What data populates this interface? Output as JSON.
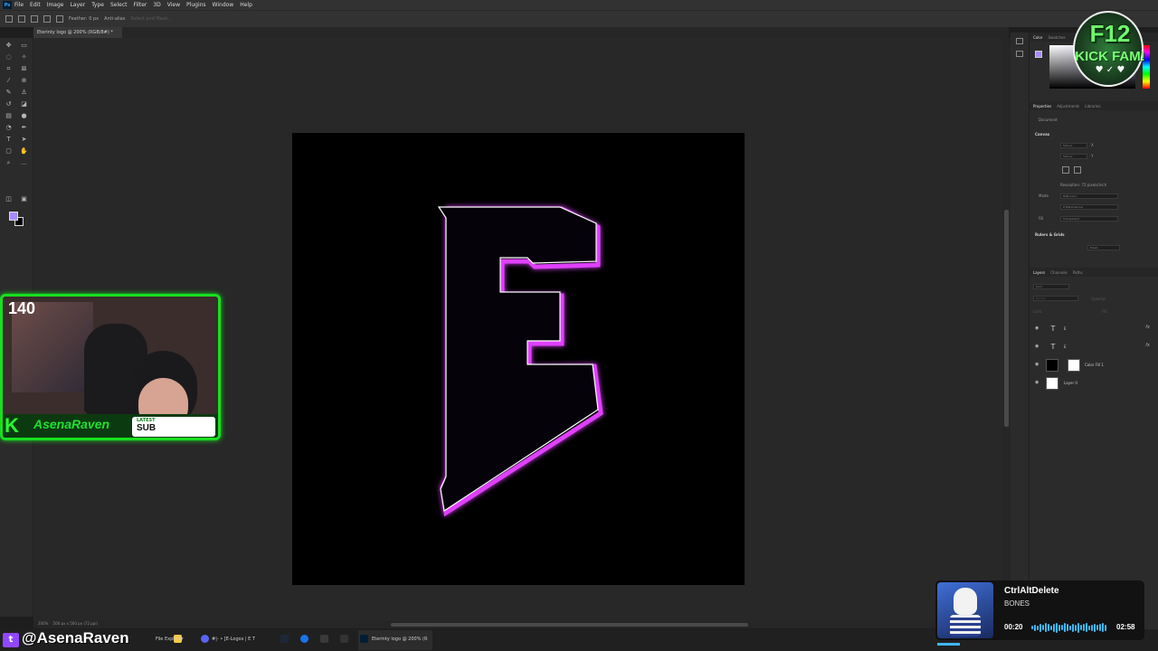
{
  "app": {
    "logo_glyph": "Ps",
    "menu": [
      "File",
      "Edit",
      "Image",
      "Layer",
      "Type",
      "Select",
      "Filter",
      "3D",
      "View",
      "Plugins",
      "Window",
      "Help"
    ]
  },
  "options_bar": {
    "feather": "Feather: 0 px",
    "anti_alias": "Anti-alias",
    "select_mask": "Select and Mask..."
  },
  "document": {
    "tab_title": "Eterinty logo @ 200% (RGB/8#) *",
    "status": "500 px x 500 px (72 ppi)",
    "zoom": "200%",
    "canvas_bg": "#000000",
    "logo_stroke": "#ffffff",
    "logo_glow": "#e040ff"
  },
  "tools": {
    "foreground_color": "#a78bfa",
    "background_color": "#000000"
  },
  "panels": {
    "color_tabs": [
      "Color",
      "Swatches"
    ],
    "props_tabs": [
      "Properties",
      "Adjustments",
      "Libraries"
    ],
    "props_doc": "Document",
    "canvas_head": "Canvas",
    "w_value": "500 px",
    "h_value": "500 px",
    "x_label": "X",
    "y_label": "Y",
    "resolution": "Resolution: 72 pixels/inch",
    "mode_label": "Mode",
    "mode_value": "RGB Color",
    "bits_value": "8 Bits/Channel",
    "fill_label": "Fill",
    "fill_value": "Transparent",
    "rulers_head": "Rulers & Grids",
    "units_value": "Pixels",
    "layers_tabs": [
      "Layers",
      "Channels",
      "Paths"
    ],
    "layer_filter": "Kind",
    "blend_mode": "Normal",
    "opacity": "Opacity:",
    "lock": "Lock:",
    "fill": "Fill:",
    "layers": [
      {
        "name": "E",
        "type": "text",
        "fx": "fx"
      },
      {
        "name": "E",
        "type": "text",
        "fx": "fx"
      },
      {
        "name": "Color Fill 1",
        "type": "fill",
        "fx": ""
      },
      {
        "name": "Layer 0",
        "type": "pixel",
        "fx": ""
      }
    ]
  },
  "overlay": {
    "viewer_count": "140",
    "streamer_name": "AsenaRaven",
    "latest_label": "LATEST",
    "latest_value": "SUB",
    "badge_line1": "F12",
    "badge_line2": "KICK FAM!",
    "badge_hearts": "♥ ✓ ♥",
    "handle": "@AsenaRaven",
    "handle_glyph": "t"
  },
  "now_playing": {
    "title": "CtrlAltDelete",
    "artist": "BONES",
    "elapsed": "00:20",
    "total": "02:58",
    "progress": 0.11,
    "accent": "#3fb6ff"
  },
  "taskbar": {
    "items": [
      "File Explorer",
      "#|- • [E-Logos | E T",
      "Eterinty logo @ 200% (R"
    ]
  }
}
